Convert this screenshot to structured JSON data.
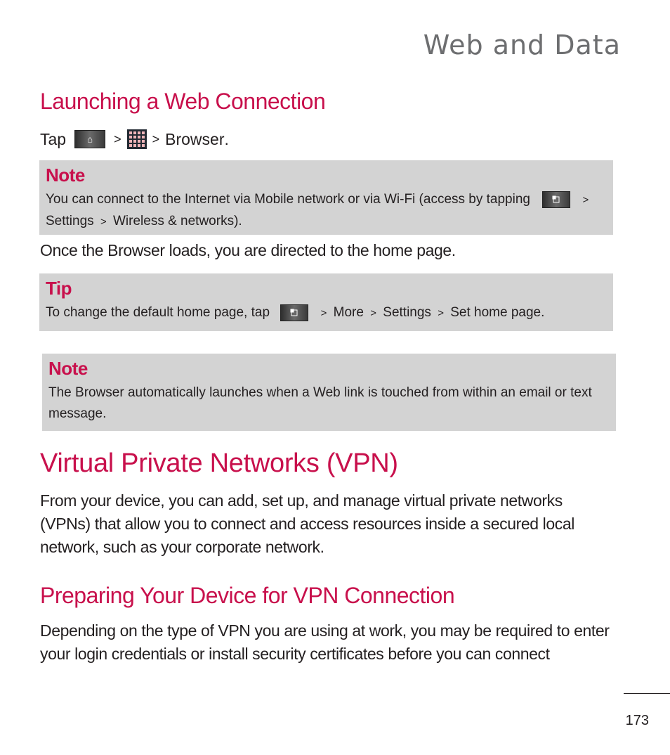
{
  "chapter_title": "Web and Data",
  "section_launching": {
    "heading": "Launching a Web Connection",
    "tap_instruction": {
      "tap_label": "Tap",
      "icons": [
        "home-key-icon",
        "applications-grid-icon"
      ],
      "separator": ">",
      "destination": "Browser",
      "period": "."
    },
    "note1": {
      "label": "Note",
      "text_before": "You can connect to the Internet via Mobile network or via Wi-Fi (access by tapping",
      "icon": "menu-key-icon",
      "separator": ">",
      "path": [
        "Settings",
        "Wireless & networks"
      ],
      "text_after": ")."
    },
    "paragraph": "Once the Browser loads, you are directed to the home page.",
    "tip": {
      "label": "Tip",
      "text_before": "To change the default home page, tap",
      "icon": "menu-key-icon",
      "separator": ">",
      "path": [
        "More",
        "Settings",
        "Set home page"
      ],
      "text_after": "."
    },
    "note2": {
      "label": "Note",
      "text": "The Browser automatically launches when a Web link is touched from within an email or text message."
    }
  },
  "section_vpn": {
    "heading": "Virtual Private Networks (VPN)",
    "paragraph": "From your device, you can add, set up, and manage virtual private networks (VPNs) that allow you to connect and access resources inside a secured local network, such as your corporate network."
  },
  "section_preparing": {
    "heading": "Preparing Your Device for VPN Connection",
    "paragraph": "Depending on the type of VPN you are using at work, you may be required to enter your login credentials or install security certificates before you can connect"
  },
  "page_number": "173",
  "colors": {
    "accent": "#c8104c",
    "callout_background": "#d3d3d3",
    "chapter_title": "#6d6e70",
    "body_text": "#231f20"
  }
}
